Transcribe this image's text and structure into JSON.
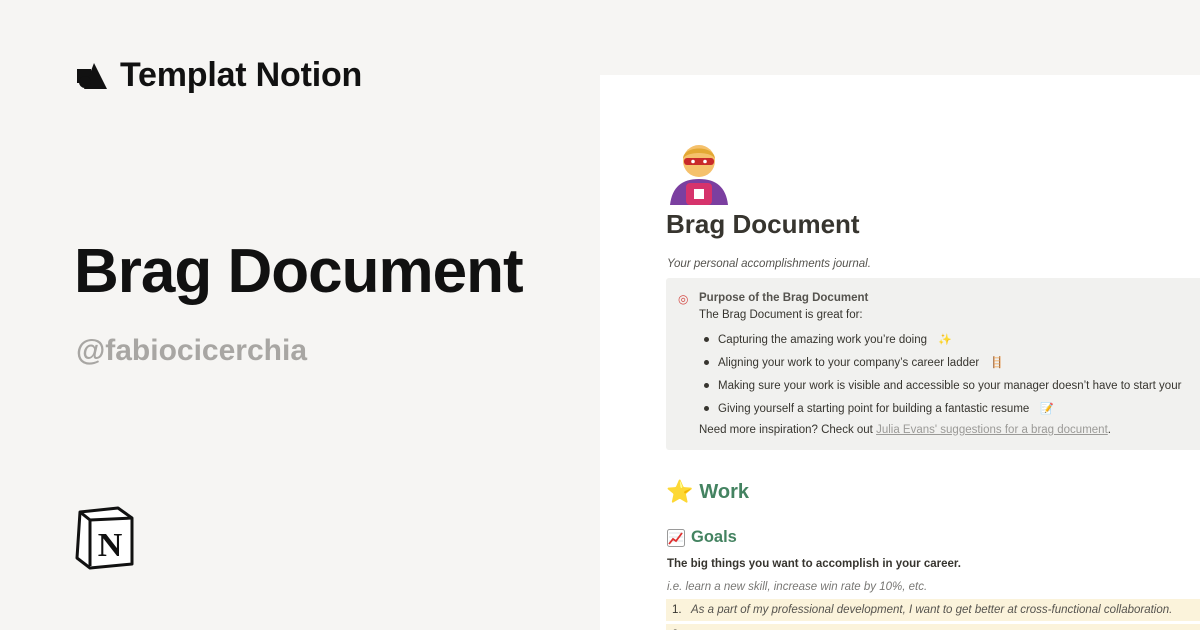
{
  "brand": {
    "name": "Templat Notion",
    "logo_icon": "templat-shapes-icon"
  },
  "hero": {
    "title": "Brag Document",
    "author": "@fabiocicerchia",
    "logo_icon": "notion-logo-icon"
  },
  "preview": {
    "page_icon": "superhero-emoji-icon",
    "title": "Brag Document",
    "subtitle": "Your personal accomplishments journal.",
    "callout": {
      "icon": "dart-target-icon",
      "heading": "Purpose of the Brag Document",
      "intro": "The Brag Document is great for:",
      "items": [
        {
          "text": "Capturing the amazing work you’re doing",
          "emoji": "✨"
        },
        {
          "text": "Aligning your work to your company’s career ladder",
          "emoji": "🪜"
        },
        {
          "text": "Making sure your work is visible and accessible so your manager doesn’t have to start your",
          "emoji": ""
        },
        {
          "text": "Giving yourself a starting point for building a fantastic resume",
          "emoji": "📝"
        }
      ],
      "footer_prefix": "Need more inspiration? Check out ",
      "footer_link": "Julia Evans' suggestions for a brag document",
      "footer_suffix": "."
    },
    "work_heading": {
      "icon": "star-icon",
      "icon_glyph": "⭐",
      "label": "Work"
    },
    "goals_heading": {
      "icon": "chart-increasing-icon",
      "label": "Goals"
    },
    "goals_description": "The big things you want to accomplish in your career.",
    "goals_hint": "i.e. learn a new skill, increase win rate by 10%, etc.",
    "goals": [
      {
        "num": "1.",
        "text": "As a part of my professional development, I want to get better at cross-functional collaboration."
      },
      {
        "num": "2.",
        "text": ""
      }
    ]
  },
  "colors": {
    "background": "#f6f5f3",
    "heading_green": "#448361",
    "callout_bg": "#f1f1ef",
    "highlight_yellow": "#fbf3db",
    "author_gray": "#a8a6a3"
  }
}
